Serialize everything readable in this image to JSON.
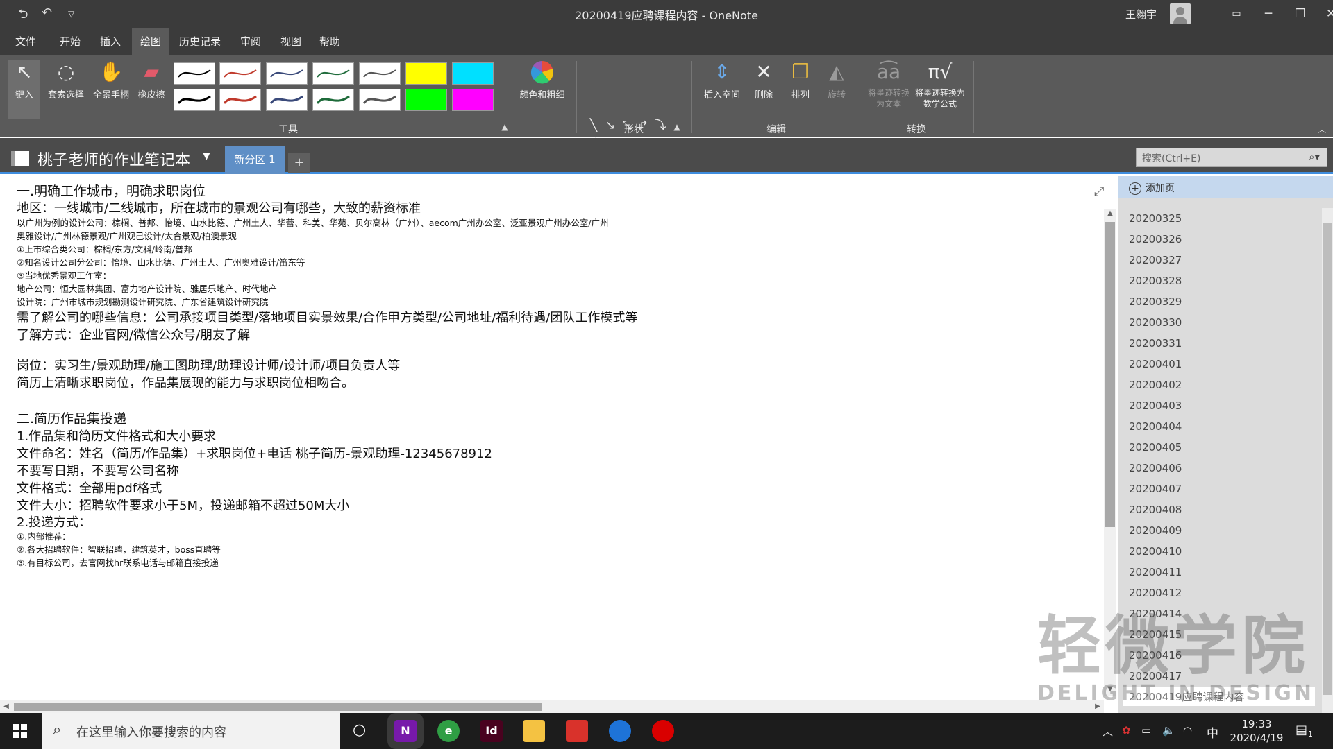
{
  "window": {
    "title": "20200419应聘课程内容 - OneNote",
    "user": "王翱宇"
  },
  "menu": [
    "文件",
    "开始",
    "插入",
    "绘图",
    "历史记录",
    "审阅",
    "视图",
    "帮助"
  ],
  "ribbon": {
    "tools": {
      "type_label": "键入",
      "lasso_label": "套索选择",
      "pan_label": "全景手柄",
      "eraser_label": "橡皮擦",
      "color_label": "颜色和粗细",
      "group": "工具"
    },
    "shapes_group": "形状",
    "edit": {
      "insert_space": "插入空间",
      "delete": "删除",
      "arrange": "排列",
      "rotate": "旋转",
      "group": "编辑"
    },
    "convert": {
      "ink_to_text": "将墨迹转换为文本",
      "ink_to_math": "将墨迹转换为数学公式",
      "group": "转换"
    },
    "pen_colors": [
      "#000000",
      "#c0392b",
      "#3a4a7a",
      "#1e6b3a",
      "#555555",
      "#000000",
      "#c0392b",
      "#3a4a7a",
      "#1e6b3a",
      "#555555"
    ],
    "highlighter_colors": [
      "#ffff00",
      "#00e0ff",
      "#00ff00",
      "#ff00ff"
    ]
  },
  "notebook": {
    "name": "桃子老师的作业笔记本",
    "section_tab": "新分区 1",
    "add_tab": "+",
    "search_placeholder": "搜索(Ctrl+E)"
  },
  "note": {
    "lines": [
      {
        "text": "一.明确工作城市，明确求职岗位",
        "size": "h1"
      },
      {
        "text": "地区：一线城市/二线城市，所在城市的景观公司有哪些，大致的薪资标准",
        "size": "big"
      },
      {
        "text": "以广州为例的设计公司：棕榈、普邦、怡境、山水比德、广州土人、华蕾、科美、华苑、贝尔高林（广州）、aecom广州办公室、泛亚景观广州办公室/广州",
        "size": "sm"
      },
      {
        "text": "奥雅设计/广州林德景观/广州观己设计/太合景观/柏澳景观",
        "size": "sm"
      },
      {
        "text": "①上市综合类公司：棕榈/东方/文科/岭南/普邦",
        "size": "sm"
      },
      {
        "text": "②知名设计公司分公司：怡境、山水比德、广州土人、广州奥雅设计/笛东等",
        "size": "sm"
      },
      {
        "text": "③当地优秀景观工作室：",
        "size": "sm"
      },
      {
        "text": "地产公司：恒大园林集团、富力地产设计院、雅居乐地产、时代地产",
        "size": "sm"
      },
      {
        "text": "设计院：广州市城市规划勘测设计研究院、广东省建筑设计研究院",
        "size": "sm"
      },
      {
        "text": "需了解公司的哪些信息：公司承接项目类型/落地项目实景效果/合作甲方类型/公司地址/福利待遇/团队工作模式等",
        "size": "big"
      },
      {
        "text": "了解方式：企业官网/微信公众号/朋友了解",
        "size": "big"
      },
      {
        "text": "岗位：实习生/景观助理/施工图助理/助理设计师/设计师/项目负责人等",
        "size": "big"
      },
      {
        "text": "简历上清晰求职岗位，作品集展现的能力与求职岗位相吻合。",
        "size": "big"
      },
      {
        "text": "二.简历作品集投递",
        "size": "h1"
      },
      {
        "text": "1.作品集和简历文件格式和大小要求",
        "size": "big"
      },
      {
        "text": "文件命名：姓名（简历/作品集）+求职岗位+电话      桃子简历-景观助理-12345678912",
        "size": "big"
      },
      {
        "text": "不要写日期，不要写公司名称",
        "size": "big"
      },
      {
        "text": "文件格式：全部用pdf格式",
        "size": "big"
      },
      {
        "text": "文件大小：招聘软件要求小于5M，投递邮箱不超过50M大小",
        "size": "big"
      },
      {
        "text": "2.投递方式：",
        "size": "big"
      },
      {
        "text": "①.内部推荐：",
        "size": "sm"
      },
      {
        "text": "②.各大招聘软件：智联招聘，建筑英才，boss直聘等",
        "size": "sm"
      },
      {
        "text": "③.有目标公司，去官网找hr联系电话与邮箱直接投递",
        "size": "sm"
      }
    ]
  },
  "pages": {
    "add_page": "添加页",
    "items": [
      "20200325",
      "20200326",
      "20200327",
      "20200328",
      "20200329",
      "20200330",
      "20200331",
      "20200401",
      "20200402",
      "20200403",
      "20200404",
      "20200405",
      "20200406",
      "20200407",
      "20200408",
      "20200409",
      "20200410",
      "20200411",
      "20200412",
      "20200414",
      "20200415",
      "20200416",
      "20200417"
    ],
    "selected": "20200419应聘课程内容"
  },
  "watermark": {
    "cn": "轻微学院",
    "en": "DELIGHT IN DESIGN"
  },
  "taskbar": {
    "search_placeholder": "在这里输入你要搜索的内容",
    "ime": "中",
    "time": "19:33",
    "date": "2020/4/19",
    "notification_count": "1",
    "apps": [
      {
        "name": "onenote",
        "label": "N",
        "color": "#7719aa"
      },
      {
        "name": "browser",
        "label": "e",
        "color": "#2f9e44"
      },
      {
        "name": "indesign",
        "label": "Id",
        "color": "#49021f"
      },
      {
        "name": "file-explorer",
        "label": "",
        "color": "#f4c242"
      },
      {
        "name": "sketchup",
        "label": "",
        "color": "#d9322b"
      },
      {
        "name": "media",
        "label": "",
        "color": "#1e73d8"
      },
      {
        "name": "recorder",
        "label": "",
        "color": "#d90000"
      }
    ]
  }
}
